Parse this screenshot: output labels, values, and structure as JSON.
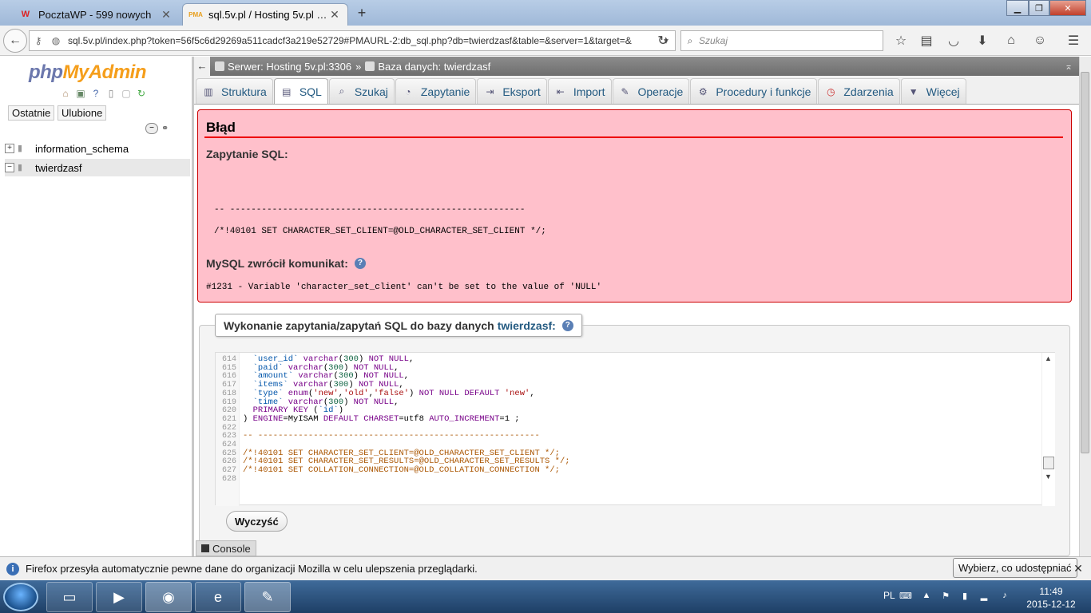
{
  "browser": {
    "tabs": [
      {
        "label": "PocztaWP - 599 nowych",
        "favicon": "W"
      },
      {
        "label": "sql.5v.pl / Hosting 5v.pl / t...",
        "favicon": "PMA"
      }
    ],
    "url": "sql.5v.pl/index.php?token=56f5c6d29269a511cadcf3a219e52729#PMAURL-2:db_sql.php?db=twierdzasf&table=&server=1&target=&",
    "search_placeholder": "Szukaj"
  },
  "sidebar": {
    "logo_php": "php",
    "logo_my": "My",
    "logo_admin": "Admin",
    "btn_recent": "Ostatnie",
    "btn_favorites": "Ulubione",
    "databases": [
      {
        "name": "information_schema",
        "expander": "+"
      },
      {
        "name": "twierdzasf",
        "expander": "−"
      }
    ]
  },
  "breadcrumb": {
    "server": "Serwer: Hosting 5v.pl:3306",
    "separator": "»",
    "database": "Baza danych: twierdzasf"
  },
  "tabs": [
    {
      "label": "Struktura",
      "icon": "structure-icon"
    },
    {
      "label": "SQL",
      "icon": "sql-icon"
    },
    {
      "label": "Szukaj",
      "icon": "search-icon"
    },
    {
      "label": "Zapytanie",
      "icon": "query-icon"
    },
    {
      "label": "Eksport",
      "icon": "export-icon"
    },
    {
      "label": "Import",
      "icon": "import-icon"
    },
    {
      "label": "Operacje",
      "icon": "wrench-icon"
    },
    {
      "label": "Procedury i funkcje",
      "icon": "routines-icon"
    },
    {
      "label": "Zdarzenia",
      "icon": "clock-icon"
    },
    {
      "label": "Więcej",
      "icon": "chevron-down-icon"
    }
  ],
  "error": {
    "title": "Błąd",
    "query_label": "Zapytanie SQL:",
    "query_dash": "-- --------------------------------------------------------",
    "query_stmt": "/*!40101 SET CHARACTER_SET_CLIENT=@OLD_CHARACTER_SET_CLIENT */;",
    "mysql_label": "MySQL zwrócił komunikat:",
    "mysql_msg": "#1231 - Variable 'character_set_client' can't be set to the value of 'NULL'"
  },
  "sql_form": {
    "legend": "Wykonanie zapytania/zapytań SQL do bazy danych",
    "db": "twierdzasf:",
    "clear_button": "Wyczyść",
    "lines": [
      {
        "n": "614",
        "t": "  `user_id` varchar(300) NOT NULL,"
      },
      {
        "n": "615",
        "t": "  `paid` varchar(300) NOT NULL,"
      },
      {
        "n": "616",
        "t": "  `amount` varchar(300) NOT NULL,"
      },
      {
        "n": "617",
        "t": "  `items` varchar(300) NOT NULL,"
      },
      {
        "n": "618",
        "t": "  `type` enum('new','old','false') NOT NULL DEFAULT 'new',"
      },
      {
        "n": "619",
        "t": "  `time` varchar(300) NOT NULL,"
      },
      {
        "n": "620",
        "t": "  PRIMARY KEY (`id`)"
      },
      {
        "n": "621",
        "t": ") ENGINE=MyISAM DEFAULT CHARSET=utf8 AUTO_INCREMENT=1 ;"
      },
      {
        "n": "622",
        "t": ""
      },
      {
        "n": "623",
        "t": "-- --------------------------------------------------------"
      },
      {
        "n": "624",
        "t": ""
      },
      {
        "n": "625",
        "t": "/*!40101 SET CHARACTER_SET_CLIENT=@OLD_CHARACTER_SET_CLIENT */;"
      },
      {
        "n": "626",
        "t": "/*!40101 SET CHARACTER_SET_RESULTS=@OLD_CHARACTER_SET_RESULTS */;"
      },
      {
        "n": "627",
        "t": "/*!40101 SET COLLATION_CONNECTION=@OLD_COLLATION_CONNECTION */;"
      },
      {
        "n": "628",
        "t": ""
      }
    ]
  },
  "console_label": "Console",
  "notification": {
    "text": "Firefox przesyła automatycznie pewne dane do organizacji Mozilla w celu ulepszenia przeglądarki.",
    "button": "Wybierz, co udostępniać"
  },
  "taskbar": {
    "lang": "PL",
    "time": "11:49",
    "date": "2015-12-12"
  },
  "colors": {
    "error_bg": "#ffc0cb",
    "error_border": "#cc0000",
    "link": "#235a81",
    "logo_orange": "#f59e1b",
    "logo_blue": "#6c78ad"
  }
}
